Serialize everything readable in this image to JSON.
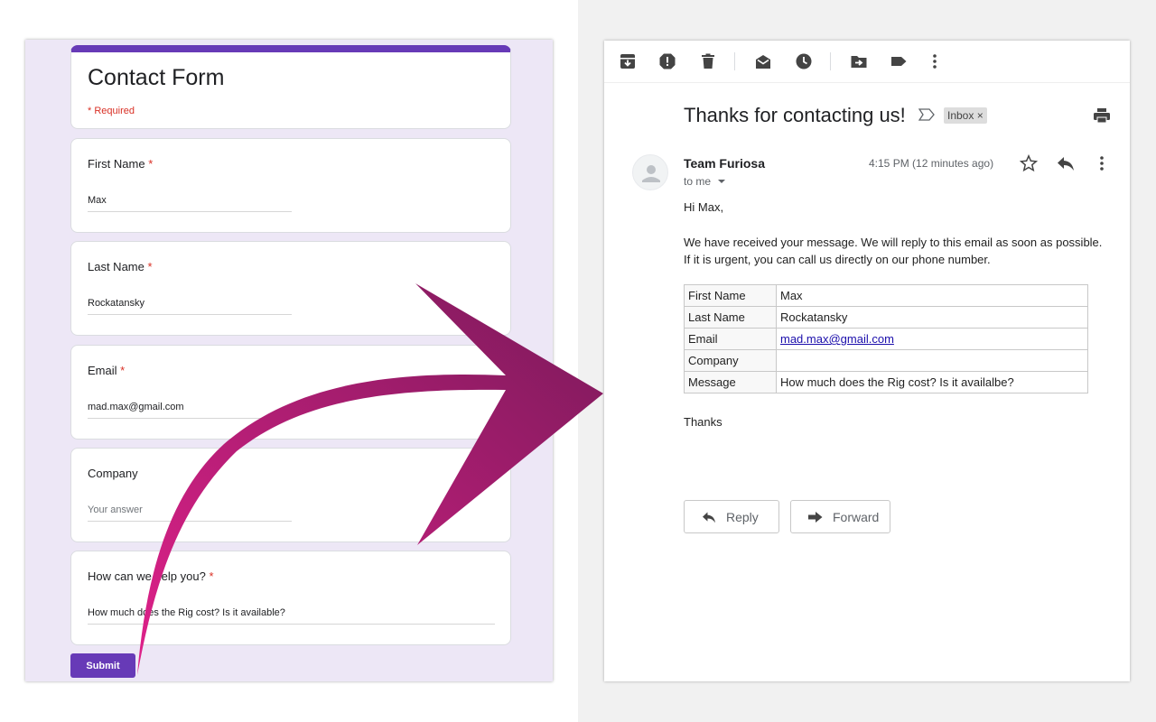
{
  "form": {
    "title": "Contact Form",
    "required_note": "* Required",
    "accent_color": "#673ab7",
    "background_color": "#ede7f6",
    "questions": [
      {
        "label": "First Name",
        "required": true,
        "value": "Max",
        "is_placeholder": false
      },
      {
        "label": "Last Name",
        "required": true,
        "value": "Rockatansky",
        "is_placeholder": false
      },
      {
        "label": "Email",
        "required": true,
        "value": "mad.max@gmail.com",
        "is_placeholder": false
      },
      {
        "label": "Company",
        "required": false,
        "value": "Your answer",
        "is_placeholder": true
      },
      {
        "label": "How can we help you?",
        "required": true,
        "value": "How much does the Rig cost? Is it available?",
        "is_placeholder": false
      }
    ],
    "required_star": "*",
    "submit_label": "Submit"
  },
  "email": {
    "toolbar_icons": [
      "archive-icon",
      "report-spam-icon",
      "delete-icon",
      "mark-unread-icon",
      "snooze-icon",
      "move-to-icon",
      "label-icon",
      "more-vert-icon"
    ],
    "subject": "Thanks for contacting us!",
    "label_chip": "Inbox",
    "label_close": "×",
    "sender": "Team Furiosa",
    "recipient": "to me",
    "timestamp": "4:15 PM (12 minutes ago)",
    "greeting": "Hi Max,",
    "body_line1": "We have received your message. We will reply to this email as soon as possible.",
    "body_line2": "If it is urgent, you can call us directly on our phone number.",
    "table": [
      {
        "key": "First Name",
        "value": "Max",
        "is_link": false
      },
      {
        "key": "Last Name",
        "value": "Rockatansky",
        "is_link": false
      },
      {
        "key": "Email",
        "value": "mad.max@gmail.com",
        "is_link": true
      },
      {
        "key": "Company",
        "value": "",
        "is_link": false
      },
      {
        "key": "Message",
        "value": "How much does the Rig cost? Is it availalbe?",
        "is_link": false
      }
    ],
    "signoff": "Thanks",
    "reply_label": "Reply",
    "forward_label": "Forward",
    "link_color": "#1a0dab"
  },
  "arrow": {
    "gradient_start": "#e0218a",
    "gradient_end": "#7a1a5a"
  }
}
